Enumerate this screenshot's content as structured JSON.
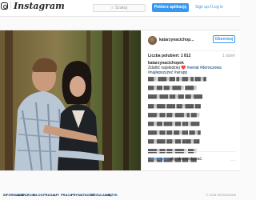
{
  "header": {
    "logo_text": "Instagram",
    "search_placeholder": "Szukaj",
    "search_icon": "search-icon",
    "get_app_label": "Pobierz aplikację",
    "signup_label": "Sign up",
    "signup_separator": " / ",
    "login_label": "Log in"
  },
  "post": {
    "username": "katarzynacichop...",
    "follow_label": "Obserwuj",
    "likes": "Liczba polubień: 1 812",
    "time": "1 dzień",
    "caption_user": "katarzynacichopek",
    "caption_text": "Zdaňić najsłodziej ❤️",
    "caption_tags": "#serial #doroczowa #najlepszyżeć #wrapp",
    "comments": [
      "▓▓▒ ▓▓▓▒▓▓ ▓▒▓▓▒▓ ▓▓▒▓",
      "▓▓▒▓▓ ▓▓▒▓▓▓▒ ▓▓▓▒",
      "▓▓▓▒▓▓▓ ▓▓▒▓▓ ▓▓▒▓▓▓",
      "▓▓▒▓▓▓ ▓▓▓ ▓▓▒▓▓▓ ▓▓",
      "▓▓▓▒▓▓ ▓▓▒▓▓▓▒▓ ▓▓▒",
      "▓▓▒▓▓ ▓▓▓▒▓▓ ▓▓▒▓▓▓",
      "▓▓▓▒▓▓ ▓▓ ▓▓▒▓▓ ▓▓▒▓",
      "▓▓▒▓▓▓ ▓▓▒▓▓ ▓▓▓▒▓▓",
      "▓▓▓▒▓▓ ▓▓▒▓▓▓▒ ▓▓▒",
      "▓▓▒▓▓ ▓▓▓▒▓▓ ▓▓▒▓▓"
    ],
    "login_link": "Zaloguj się,",
    "login_text": " aby skomentować.",
    "more_icon": "ellipsis-icon",
    "more_text": "···"
  },
  "footer": {
    "links": [
      "INFORMACJE",
      "WSPARCIE",
      "BLOG",
      "PRASA",
      "API",
      "PRACA",
      "PRYWATNOŚĆ",
      "REGULAMIN",
      "JĘZYK"
    ],
    "copyright": "© 2018 INSTAGRAM"
  },
  "colors": {
    "accent": "#3897f0",
    "link": "#003569",
    "text": "#262626",
    "muted": "#999999",
    "background": "#fafafa"
  }
}
